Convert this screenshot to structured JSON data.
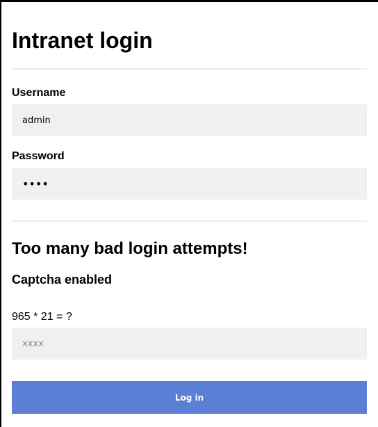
{
  "page": {
    "title": "Intranet login"
  },
  "form": {
    "username_label": "Username",
    "username_value": "admin",
    "password_label": "Password",
    "password_value": "••••"
  },
  "warning": {
    "message": "Too many bad login attempts!",
    "captcha_heading": "Captcha enabled",
    "captcha_question": "965 * 21 = ?",
    "captcha_placeholder": "xxxx"
  },
  "actions": {
    "login_label": "Log in"
  },
  "colors": {
    "button": "#5b7fd4",
    "input_bg": "#f0f0f0",
    "divider": "#eeeeee"
  }
}
